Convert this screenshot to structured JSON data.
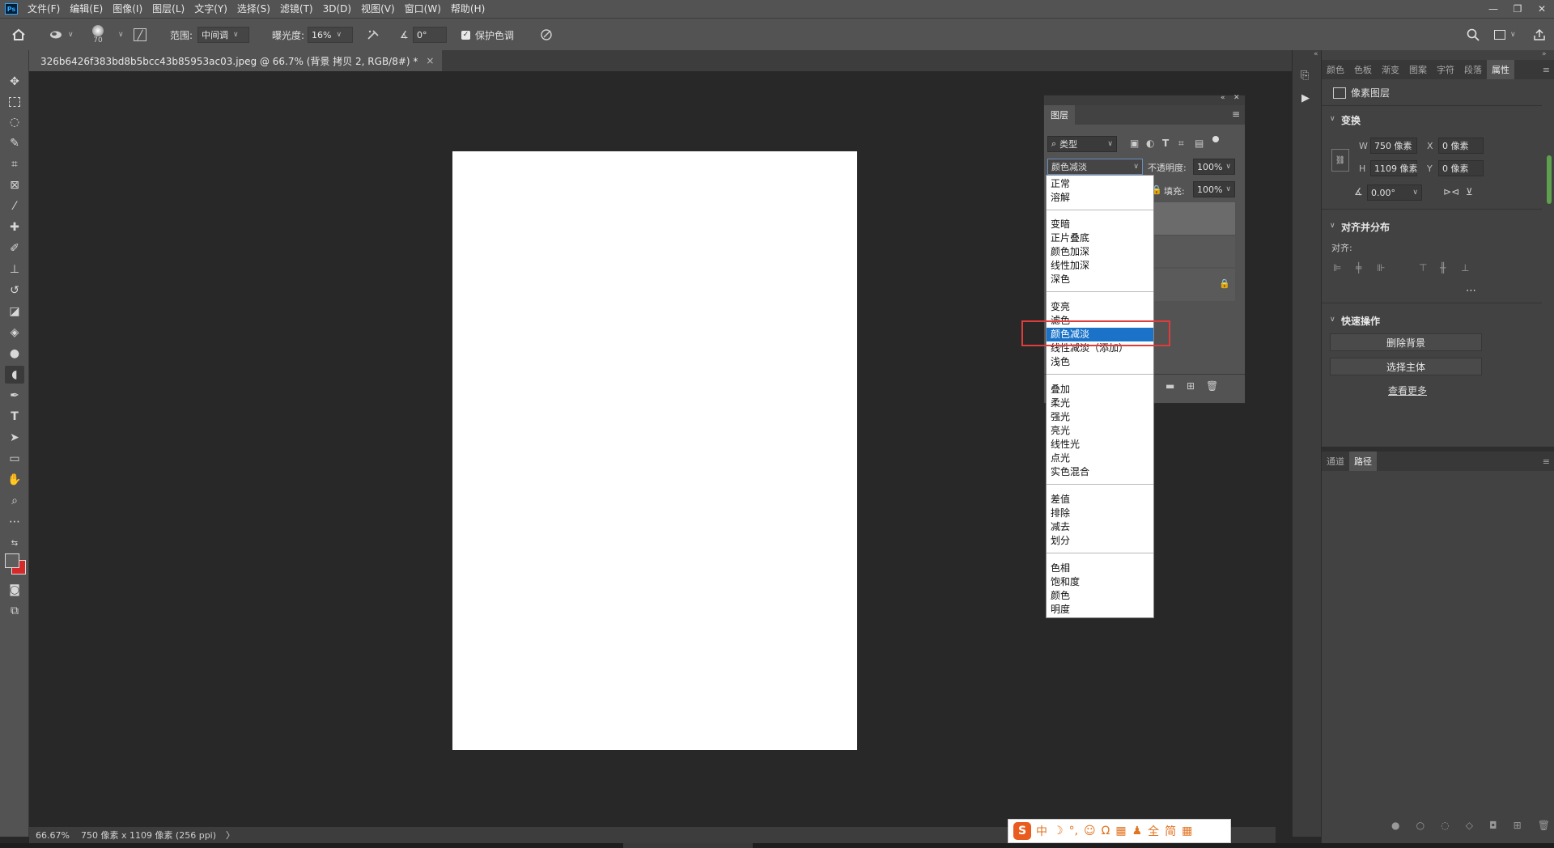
{
  "app": {
    "logo": "Ps",
    "menus": [
      "文件(F)",
      "编辑(E)",
      "图像(I)",
      "图层(L)",
      "文字(Y)",
      "选择(S)",
      "滤镜(T)",
      "3D(D)",
      "视图(V)",
      "窗口(W)",
      "帮助(H)"
    ]
  },
  "options": {
    "brush_size": "70",
    "range_label": "范围:",
    "range_value": "中间调",
    "exposure_label": "曝光度:",
    "exposure_value": "16%",
    "angle_value": "0°",
    "protect_tones_label": "保护色调"
  },
  "document": {
    "tab_title": "326b6426f383bd8b5bcc43b85953ac03.jpeg @ 66.7% (背景 拷贝 2, RGB/8#) *",
    "zoom": "66.67%",
    "info": "750 像素 x 1109 像素 (256 ppi)"
  },
  "layers_panel": {
    "title": "图层",
    "filter_kind": "类型",
    "blend_mode": "颜色减淡",
    "opacity_label": "不透明度:",
    "opacity_value": "100%",
    "fill_label": "填充:",
    "fill_value": "100%"
  },
  "blend_modes": {
    "groups": [
      [
        "正常",
        "溶解"
      ],
      [
        "变暗",
        "正片叠底",
        "颜色加深",
        "线性加深",
        "深色"
      ],
      [
        "变亮",
        "滤色",
        "颜色减淡",
        "线性减淡（添加）",
        "浅色"
      ],
      [
        "叠加",
        "柔光",
        "强光",
        "亮光",
        "线性光",
        "点光",
        "实色混合"
      ],
      [
        "差值",
        "排除",
        "减去",
        "划分"
      ],
      [
        "色相",
        "饱和度",
        "颜色",
        "明度"
      ]
    ],
    "selected": "颜色减淡"
  },
  "right_panel": {
    "tabs": [
      "颜色",
      "色板",
      "渐变",
      "图案",
      "字符",
      "段落",
      "属性"
    ],
    "active_tab": "属性",
    "layer_type": "像素图层",
    "transform": {
      "title": "变换",
      "w_label": "W",
      "w_value": "750 像素",
      "x_label": "X",
      "x_value": "0 像素",
      "h_label": "H",
      "h_value": "1109 像素",
      "y_label": "Y",
      "y_value": "0 像素",
      "angle_value": "0.00°"
    },
    "align": {
      "title": "对齐并分布",
      "label": "对齐:"
    },
    "quick_actions": {
      "title": "快速操作",
      "remove_bg": "删除背景",
      "select_subject": "选择主体",
      "more": "查看更多"
    },
    "bottom_tabs": [
      "通道",
      "路径"
    ],
    "bottom_active": "路径"
  },
  "ime": {
    "logo": "S",
    "chars": [
      "中",
      "☽",
      "°,",
      "☺",
      "Ω",
      "▦",
      "♟",
      "全",
      "简",
      "▦"
    ]
  },
  "colors": {
    "chrome": "#535353",
    "canvas_bg": "#282828",
    "selection": "#1a73c8",
    "highlight": "#e03c3c",
    "background_swatch": "#d42a2a"
  }
}
